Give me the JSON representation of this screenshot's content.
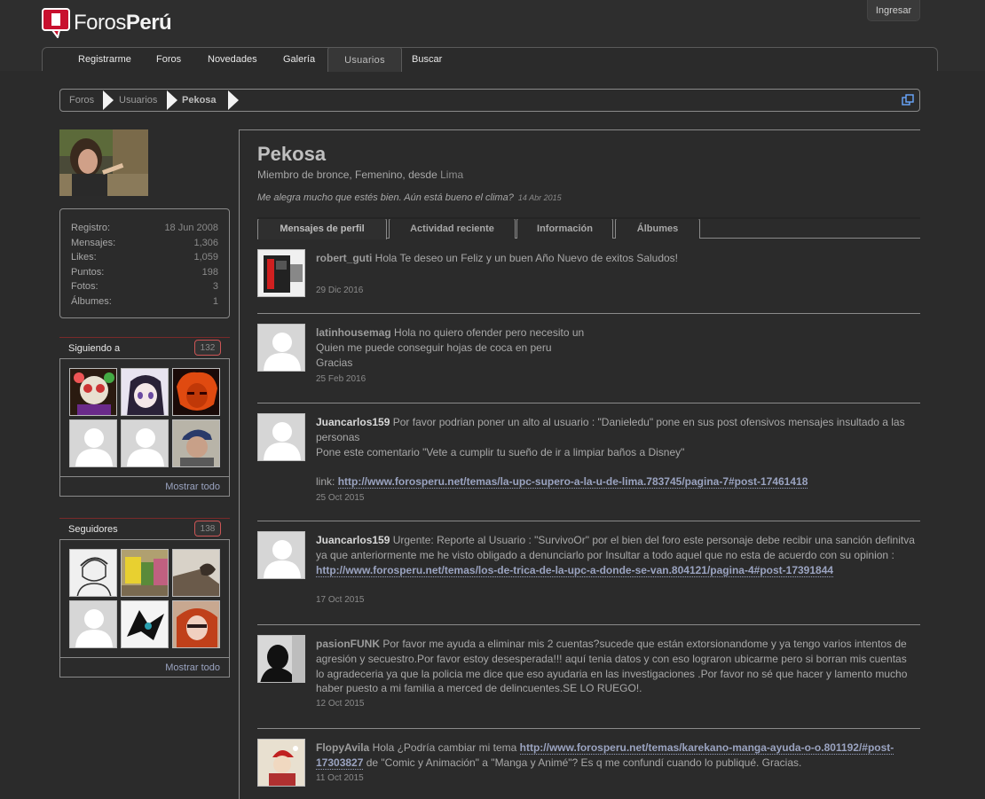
{
  "site": {
    "logo_word_regular": "Foros",
    "logo_word_bold": "Perú",
    "login_label": "Ingresar"
  },
  "nav": {
    "items": [
      "Registrarme",
      "Foros",
      "Novedades",
      "Galería",
      "Usuarios",
      "Buscar"
    ],
    "active": "Usuarios"
  },
  "breadcrumb": [
    "Foros",
    "Usuarios",
    "Pekosa"
  ],
  "profile": {
    "name": "Pekosa",
    "meta_prefix": "Miembro de bronce, Femenino, desde ",
    "location": "Lima",
    "status": "Me alegra mucho que estés bien. Aún está bueno el clima?",
    "status_date": "14 Abr 2015"
  },
  "stats": [
    {
      "label": "Registro:",
      "value": "18 Jun 2008"
    },
    {
      "label": "Mensajes:",
      "value": "1,306"
    },
    {
      "label": "Likes:",
      "value": "1,059"
    },
    {
      "label": "Puntos:",
      "value": "198"
    },
    {
      "label": "Fotos:",
      "value": "3"
    },
    {
      "label": "Álbumes:",
      "value": "1"
    }
  ],
  "following": {
    "title": "Siguiendo a",
    "count": "132",
    "more": "Mostrar todo"
  },
  "followers": {
    "title": "Seguidores",
    "count": "138",
    "more": "Mostrar todo"
  },
  "tabs": [
    "Mensajes de perfil",
    "Actividad reciente",
    "Información",
    "Álbumes"
  ],
  "posts": [
    {
      "author": "robert_guti",
      "text": " Hola Te deseo un Feliz y un buen Año Nuevo de exitos Saludos!",
      "date": "29 Dic 2016"
    },
    {
      "author": "latinhousemag",
      "line1": " Hola no quiero ofender pero necesito un",
      "line2": "Quien me puede conseguir hojas de coca en peru",
      "line3": "Gracias",
      "date": "25 Feb 2016"
    },
    {
      "author": "Juancarlos159",
      "line1": " Por favor podrian poner un alto al usuario : \"Danieledu\" pone en sus post ofensivos mensajes insultado a las personas",
      "line2": "Pone este comentario \"Vete a cumplir tu sueño de ir a limpiar baños a Disney\"",
      "link_prefix": "link: ",
      "link": "http://www.forosperu.net/temas/la-upc-supero-a-la-u-de-lima.783745/pagina-7#post-17461418",
      "date": "25 Oct 2015"
    },
    {
      "author": "Juancarlos159",
      "text": " Urgente: Reporte al Usuario : \"SurvivoOr\" por el bien del foro este personaje debe recibir una sanción definitva ya que anteriormente me he visto obligado a denunciarlo por Insultar a todo aquel que no esta de acuerdo con su opinion : ",
      "link": "http://www.forosperu.net/temas/los-de-trica-de-la-upc-a-donde-se-van.804121/pagina-4#post-17391844",
      "date": "17 Oct 2015"
    },
    {
      "author": "pasionFUNK",
      "text": " Por favor me ayuda a eliminar mis 2 cuentas?sucede que están extorsionandome y ya tengo varios intentos de agresión y secuestro.Por favor estoy desesperada!!! aquí tenia datos y con eso lograron ubicarme pero si borran mis cuentas lo agradeceria ya que la policia me dice que eso ayudaria en las investigaciones .Por favor no sé que hacer y lamento mucho haber puesto a mi familia a merced de delincuentes.SE LO RUEGO!.",
      "date": "12 Oct 2015"
    },
    {
      "author": "FlopyAvila",
      "text": " Hola ¿Podría cambiar mi tema ",
      "link": "http://www.forosperu.net/temas/karekano-manga-ayuda-o-o.801192/#post-17303827",
      "text_after": " de \"Comic y Animación\" a \"Manga y Animé\"? Es q me confundí cuando lo publiqué. Gracias.",
      "date": "11 Oct 2015"
    }
  ],
  "colors": {
    "accent": "#c8102e",
    "link": "#9aa3c0",
    "background": "#2b2b2b"
  }
}
